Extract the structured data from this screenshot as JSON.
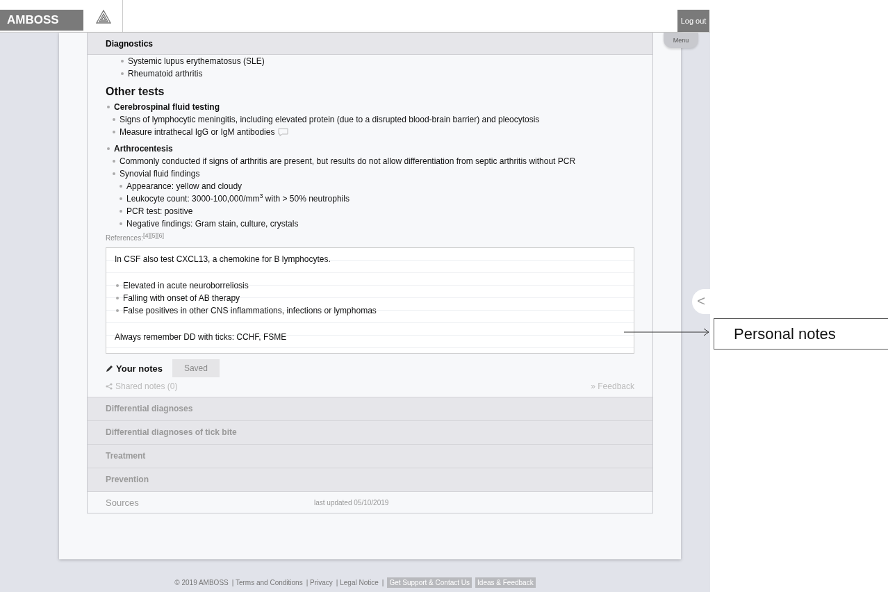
{
  "header": {
    "logo": "AMBOSS",
    "logout": "Log out",
    "menu": "Menu"
  },
  "section": {
    "title": "Diagnostics",
    "top_items": [
      "Systemic lupus erythematosus (SLE)",
      "Rheumatoid arthritis"
    ],
    "heading": "Other tests",
    "items": [
      {
        "text": "Cerebrospinal fluid testing",
        "children": [
          {
            "text": "Signs of lymphocytic meningitis, including elevated protein (due to a disrupted blood-brain barrier) and pleocytosis"
          },
          {
            "text": "Measure intrathecal IgG or IgM antibodies",
            "comment": true
          }
        ]
      },
      {
        "text": "Arthrocentesis",
        "children": [
          {
            "text": "Commonly conducted if signs of arthritis are present, but results do not allow differentiation from septic arthritis without PCR"
          },
          {
            "text": "Synovial fluid findings",
            "children": [
              {
                "text": "Appearance: yellow and cloudy"
              },
              {
                "text": "Leukocyte count: 3000-100,000/mm$^{3}$ with > 50% neutrophils"
              },
              {
                "text": "PCR test: positive"
              },
              {
                "text": "Negative findings: Gram stain, culture, crystals"
              }
            ]
          }
        ]
      }
    ],
    "references": "References:$^{[4][5][6]}$"
  },
  "notes": {
    "blocks": [
      {
        "kind": "text",
        "text": "In CSF also test CXCL13, a chemokine for B lymphocytes."
      },
      {
        "kind": "list",
        "items": [
          "Elevated in acute neuroborreliosis",
          "Falling with onset of AB therapy",
          "False positives in other CNS inflammations, infections or lymphomas"
        ]
      },
      {
        "kind": "text",
        "text": "Always remember DD with ticks: CCHF, FSME"
      }
    ],
    "label": "Your notes",
    "save_button": "Saved",
    "save_disabled": true,
    "shared": "Shared notes (0)",
    "feedback": "» Feedback"
  },
  "collapsed_sections": [
    "Differential diagnoses",
    "Differential diagnoses of tick bite",
    "Treatment",
    "Prevention"
  ],
  "sources": {
    "title": "Sources",
    "updated": "last updated 05/10/2019"
  },
  "side_tab": "<",
  "footer": [
    {
      "kind": "plain",
      "text": "© 2019 AMBOSS"
    },
    {
      "kind": "plain",
      "text": "| Terms and Conditions"
    },
    {
      "kind": "plain",
      "text": "| Privacy"
    },
    {
      "kind": "plain",
      "text": "| Legal Notice"
    },
    {
      "kind": "plain",
      "text": "|"
    },
    {
      "kind": "button",
      "text": "Get Support & Contact Us"
    },
    {
      "kind": "button",
      "text": "Ideas & Feedback"
    }
  ],
  "annotation": "Personal notes"
}
